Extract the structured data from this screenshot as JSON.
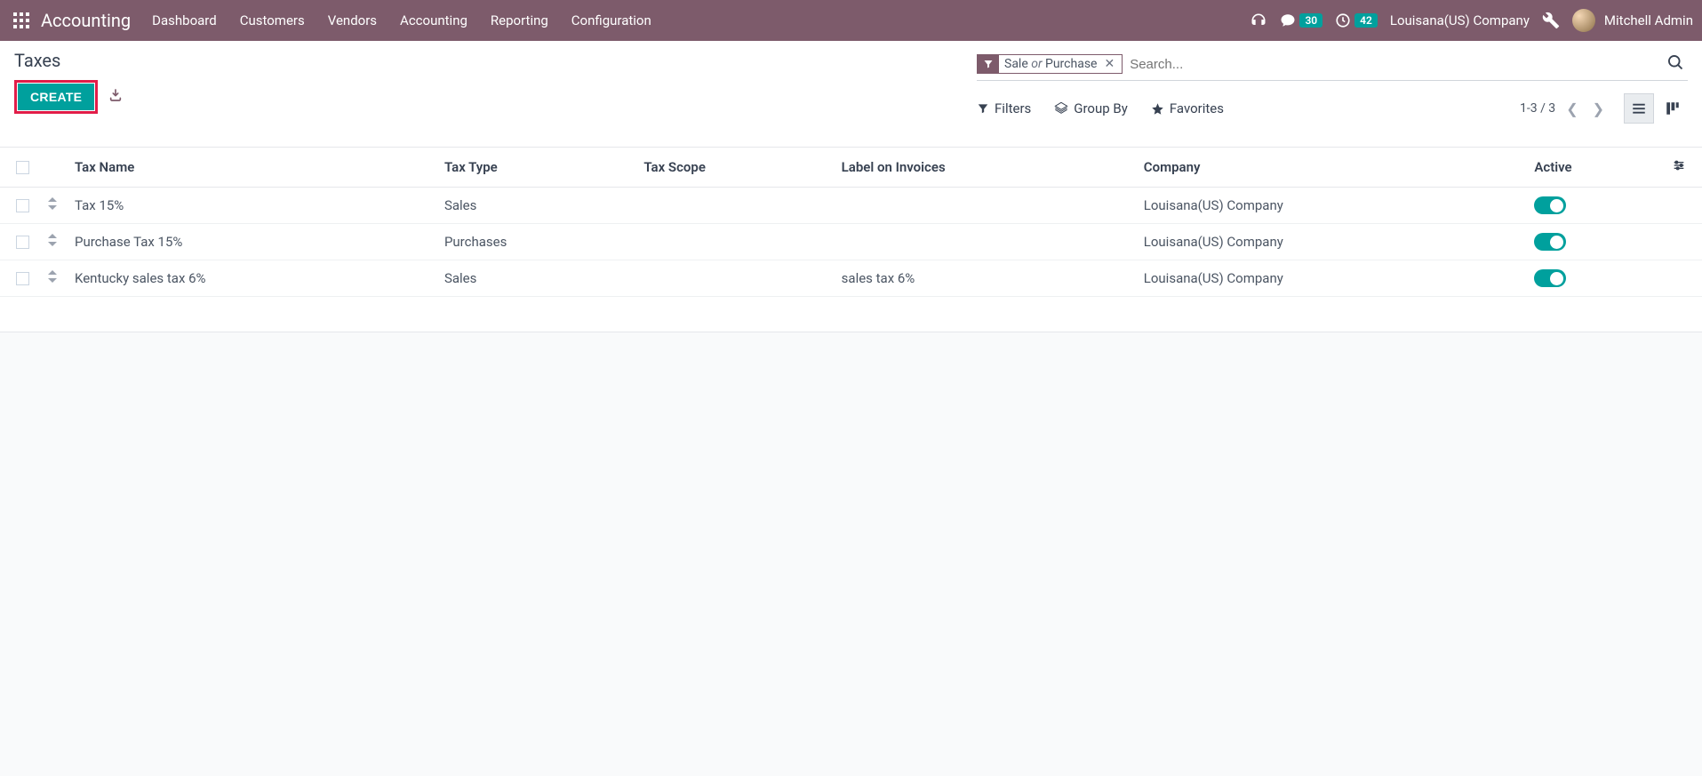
{
  "topnav": {
    "app_title": "Accounting",
    "menu": [
      "Dashboard",
      "Customers",
      "Vendors",
      "Accounting",
      "Reporting",
      "Configuration"
    ],
    "badge_messages": "30",
    "badge_activities": "42",
    "company": "Louisana(US) Company",
    "user": "Mitchell Admin"
  },
  "control": {
    "breadcrumb": "Taxes",
    "create_label": "CREATE",
    "facet_part1": "Sale",
    "facet_or": " or ",
    "facet_part2": "Purchase",
    "search_placeholder": "Search...",
    "filters_label": "Filters",
    "groupby_label": "Group By",
    "favorites_label": "Favorites",
    "pager_text": "1-3 / 3"
  },
  "table": {
    "headers": {
      "name": "Tax Name",
      "type": "Tax Type",
      "scope": "Tax Scope",
      "label": "Label on Invoices",
      "company": "Company",
      "active": "Active"
    },
    "rows": [
      {
        "name": "Tax 15%",
        "type": "Sales",
        "scope": "",
        "label": "",
        "company": "Louisana(US) Company",
        "active": true
      },
      {
        "name": "Purchase Tax 15%",
        "type": "Purchases",
        "scope": "",
        "label": "",
        "company": "Louisana(US) Company",
        "active": true
      },
      {
        "name": "Kentucky sales tax 6%",
        "type": "Sales",
        "scope": "",
        "label": "sales tax 6%",
        "company": "Louisana(US) Company",
        "active": true
      }
    ]
  }
}
